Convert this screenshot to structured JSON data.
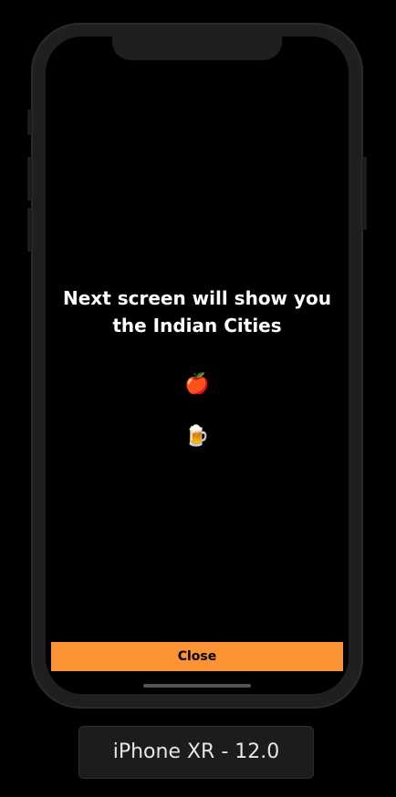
{
  "screen": {
    "headline": "Next screen will show you the Indian Cities",
    "emojis": {
      "apple": "🍎",
      "beer": "🍺"
    },
    "close_label": "Close",
    "accent_color": "#fb9233"
  },
  "simulator": {
    "device_label": "iPhone XR - 12.0"
  }
}
